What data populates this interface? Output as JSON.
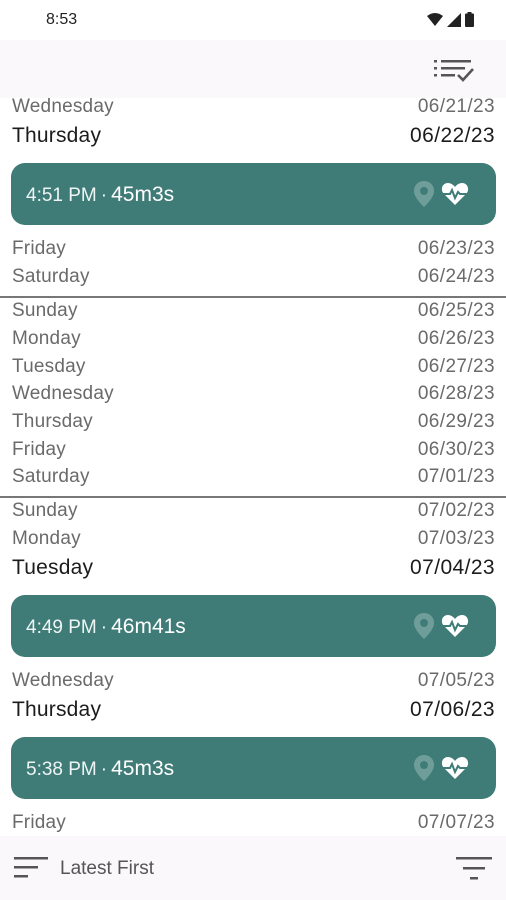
{
  "status_bar": {
    "time": "8:53"
  },
  "app_bar": {
    "sort_icon": "checklist-sort-icon"
  },
  "list": {
    "rows": [
      {
        "day": "Wednesday",
        "date": "06/21/23",
        "bold": false
      },
      {
        "day": "Thursday",
        "date": "06/22/23",
        "bold": true
      },
      {
        "day": "Friday",
        "date": "06/23/23",
        "bold": false
      },
      {
        "day": "Saturday",
        "date": "06/24/23",
        "bold": false
      },
      {
        "day": "Sunday",
        "date": "06/25/23",
        "bold": false
      },
      {
        "day": "Monday",
        "date": "06/26/23",
        "bold": false
      },
      {
        "day": "Tuesday",
        "date": "06/27/23",
        "bold": false
      },
      {
        "day": "Wednesday",
        "date": "06/28/23",
        "bold": false
      },
      {
        "day": "Thursday",
        "date": "06/29/23",
        "bold": false
      },
      {
        "day": "Friday",
        "date": "06/30/23",
        "bold": false
      },
      {
        "day": "Saturday",
        "date": "07/01/23",
        "bold": false
      },
      {
        "day": "Sunday",
        "date": "07/02/23",
        "bold": false
      },
      {
        "day": "Monday",
        "date": "07/03/23",
        "bold": false
      },
      {
        "day": "Tuesday",
        "date": "07/04/23",
        "bold": true
      },
      {
        "day": "Wednesday",
        "date": "07/05/23",
        "bold": false
      },
      {
        "day": "Thursday",
        "date": "07/06/23",
        "bold": true
      },
      {
        "day": "Friday",
        "date": "07/07/23",
        "bold": false
      }
    ],
    "sessions": [
      {
        "time": "4:51 PM",
        "separator": "·",
        "duration": "45m3s"
      },
      {
        "time": "4:49 PM",
        "separator": "·",
        "duration": "46m41s"
      },
      {
        "time": "5:38 PM",
        "separator": "·",
        "duration": "45m3s"
      }
    ]
  },
  "bottom_bar": {
    "order_label": "Latest First"
  },
  "colors": {
    "session_bg": "#3f7c78",
    "bar_bg": "#faf8fa"
  }
}
